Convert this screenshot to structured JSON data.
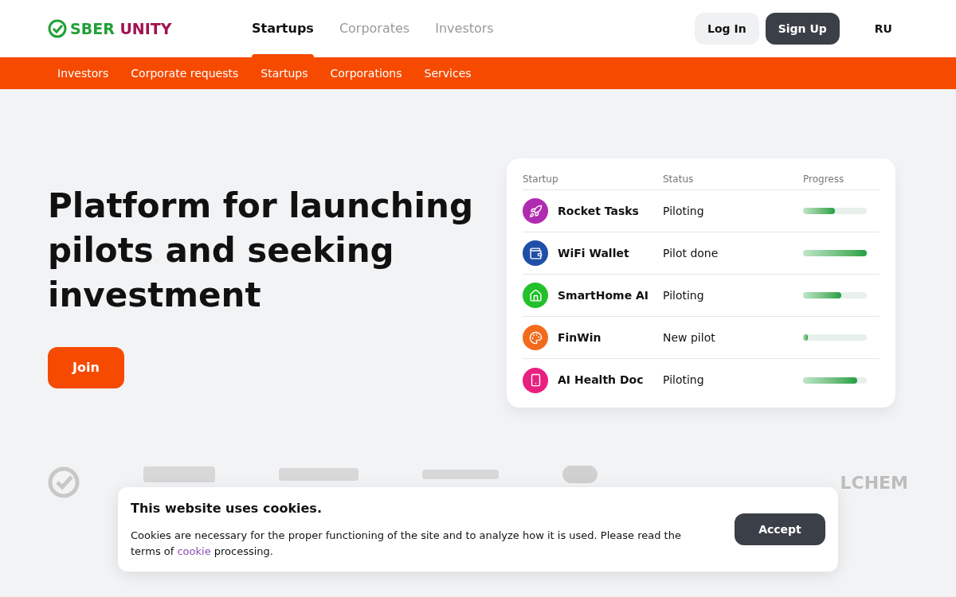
{
  "header": {
    "logo": {
      "word_1": "SBER",
      "word_2": "UNITY"
    },
    "tabs": [
      {
        "label": "Startups",
        "selected": true
      },
      {
        "label": "Corporates",
        "selected": false
      },
      {
        "label": "Investors",
        "selected": false
      }
    ],
    "login": "Log In",
    "signup": "Sign Up",
    "language": "RU"
  },
  "subnav": [
    "Investors",
    "Corporate requests",
    "Startups",
    "Corporations",
    "Services"
  ],
  "hero": {
    "title": "Platform for launching pilots and seeking investment",
    "button": "Join"
  },
  "table": {
    "columns": [
      "Startup",
      "Status",
      "Progress"
    ],
    "rows": [
      {
        "kind": "rocket",
        "color": "#b02bb0",
        "name": "Rocket Tasks",
        "status": "Piloting",
        "level": 0.5
      },
      {
        "kind": "wallet",
        "color": "#1e4fa8",
        "name": "WiFi Wallet",
        "status": "Pilot done",
        "level": 1
      },
      {
        "kind": "home",
        "color": "#22c02a",
        "name": "SmartHome AI",
        "status": "Piloting",
        "level": 0.6
      },
      {
        "kind": "palette",
        "color": "#f26b1d",
        "name": "FinWin",
        "status": "New pilot",
        "level": 0.08
      },
      {
        "kind": "phone",
        "color": "#e8207f",
        "name": "AI Health Doc",
        "status": "Piloting",
        "level": 0.85
      }
    ]
  },
  "logos": {
    "last_text": "LCHEM"
  },
  "cookie": {
    "title": "This website uses cookies.",
    "text_before": "Cookies are necessary for the proper functioning of the site and to analyze how it is used. Please read the terms of",
    "link": "cookie",
    "text_after": "processing.",
    "button": "Accept"
  }
}
